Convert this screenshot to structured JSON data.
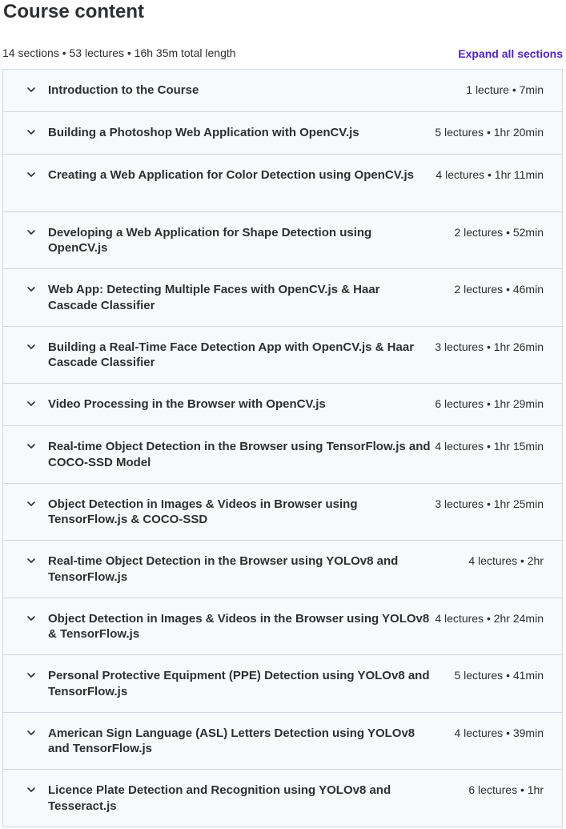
{
  "header": {
    "title": "Course content",
    "summary": "14 sections • 53 lectures • 16h 35m total length",
    "expand_label": "Expand all sections"
  },
  "sections": [
    {
      "title": "Introduction to the Course",
      "meta": "1 lecture • 7min"
    },
    {
      "title": "Building a Photoshop Web Application with OpenCV.js",
      "meta": "5 lectures • 1hr 20min"
    },
    {
      "title": "Creating a Web Application for Color Detection using OpenCV.js",
      "meta": "4 lectures • 1hr 11min"
    },
    {
      "title": "Developing a Web Application for Shape Detection using OpenCV.js",
      "meta": "2 lectures • 52min"
    },
    {
      "title": "Web App: Detecting Multiple Faces with OpenCV.js & Haar Cascade Classifier",
      "meta": "2 lectures • 46min"
    },
    {
      "title": "Building a Real-Time Face Detection App with OpenCV.js & Haar Cascade Classifier",
      "meta": "3 lectures • 1hr 26min"
    },
    {
      "title": "Video Processing in the Browser with OpenCV.js",
      "meta": "6 lectures • 1hr 29min"
    },
    {
      "title": "Real-time Object Detection in the Browser using TensorFlow.js and COCO-SSD Model",
      "meta": "4 lectures • 1hr 15min"
    },
    {
      "title": "Object Detection in Images & Videos in Browser using TensorFlow.js & COCO-SSD",
      "meta": "3 lectures • 1hr 25min"
    },
    {
      "title": "Real-time Object Detection in the Browser using YOLOv8 and TensorFlow.js",
      "meta": "4 lectures • 2hr"
    },
    {
      "title": "Object Detection in Images & Videos in the Browser using YOLOv8 & TensorFlow.js",
      "meta": "4 lectures • 2hr 24min"
    },
    {
      "title": "Personal Protective Equipment (PPE) Detection using YOLOv8 and TensorFlow.js",
      "meta": "5 lectures • 41min"
    },
    {
      "title": "American Sign Language (ASL) Letters Detection using YOLOv8 and TensorFlow.js",
      "meta": "4 lectures • 39min"
    },
    {
      "title": "Licence Plate Detection and Recognition using YOLOv8 and Tesseract.js",
      "meta": "6 lectures • 1hr"
    }
  ],
  "icons": {
    "section_toggle": "chevron-down-icon"
  },
  "colors": {
    "accent": "#5022c3",
    "section_bg": "#f7f9fa",
    "border": "#d1d7dc",
    "text": "#2d2f31"
  }
}
